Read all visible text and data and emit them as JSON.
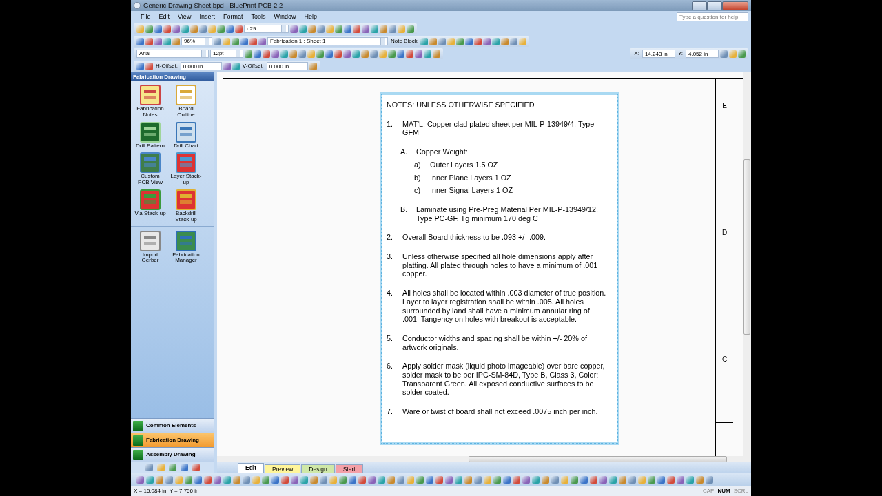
{
  "window": {
    "title": "Generic Drawing Sheet.bpd - BluePrint-PCB 2.2"
  },
  "help_box": {
    "placeholder": "Type a question for help"
  },
  "menu": [
    "File",
    "Edit",
    "View",
    "Insert",
    "Format",
    "Tools",
    "Window",
    "Help"
  ],
  "toolbars": [
    {
      "left": [
        {
          "kind": "icons"
        },
        {
          "kind": "combo",
          "value": "u29"
        },
        {
          "kind": "icons"
        }
      ]
    },
    {
      "left": [
        {
          "kind": "icons"
        },
        {
          "kind": "combo",
          "value": "96%"
        },
        {
          "kind": "icons"
        },
        {
          "kind": "combo",
          "value": "Fabrication 1 : Sheet 1"
        },
        {
          "kind": "menu",
          "value": "Note Block"
        },
        {
          "kind": "icons"
        }
      ]
    },
    {
      "left": [
        {
          "kind": "combo",
          "value": "Arial"
        },
        {
          "kind": "combo",
          "value": "12pt"
        },
        {
          "kind": "icons"
        }
      ],
      "right": [
        {
          "kind": "label",
          "value": "X:"
        },
        {
          "kind": "field",
          "value": "14.243 in"
        },
        {
          "kind": "label",
          "value": "Y:"
        },
        {
          "kind": "field",
          "value": "4.052 in"
        },
        {
          "kind": "icons"
        }
      ]
    },
    {
      "left": [
        {
          "kind": "icons"
        },
        {
          "kind": "label",
          "value": "H-Offset:"
        },
        {
          "kind": "field",
          "value": "0.000 in"
        },
        {
          "kind": "icons"
        },
        {
          "kind": "label",
          "value": "V-Offset:"
        },
        {
          "kind": "field",
          "value": "0.000 in"
        },
        {
          "kind": "icons"
        }
      ]
    }
  ],
  "sidebar": {
    "title": "Fabrication Drawing",
    "items": [
      {
        "label": "Fabrication Notes"
      },
      {
        "label": "Board Outline"
      },
      {
        "label": "Drill Pattern"
      },
      {
        "label": "Drill Chart"
      },
      {
        "label": "Custom PCB View"
      },
      {
        "label": "Layer Stack-up"
      },
      {
        "label": "Via Stack-up"
      },
      {
        "label": "Backdrill Stack-up"
      }
    ],
    "extra_items": [
      {
        "label": "Import Gerber"
      },
      {
        "label": "Fabrication Manager"
      }
    ],
    "sections": [
      {
        "label": "Common Elements",
        "selected": false
      },
      {
        "label": "Fabrication Drawing",
        "selected": true
      },
      {
        "label": "Assembly Drawing",
        "selected": false
      }
    ]
  },
  "document": {
    "title": "NOTES: UNLESS OTHERWISE SPECIFIED",
    "notes": [
      {
        "number": "1.",
        "text": "MAT'L: Copper clad plated sheet per MIL-P-13949/4, Type GFM.",
        "children": [
          {
            "number": "A.",
            "text": "Copper Weight:",
            "children": [
              {
                "number": "a)",
                "text": "Outer Layers 1.5 OZ"
              },
              {
                "number": "b)",
                "text": "Inner Plane Layers 1 OZ"
              },
              {
                "number": "c)",
                "text": "Inner Signal Layers 1 OZ"
              }
            ]
          },
          {
            "number": "B.",
            "text": "Laminate using Pre-Preg Material Per MIL-P-13949/12, Type PC-GF. Tg minimum 170 deg C"
          }
        ]
      },
      {
        "number": "2.",
        "text": "Overall Board thickness to be .093 +/- .009."
      },
      {
        "number": "3.",
        "text": "Unless otherwise specified all hole dimensions apply after platting. All plated through holes to have a minimum of .001 copper."
      },
      {
        "number": "4.",
        "text": "All holes shall be located within .003 diameter of true position. Layer to layer registration shall be within .005. All holes surrounded by land shall have a minimum annular ring of .001. Tangency on holes with breakout is acceptable."
      },
      {
        "number": "5.",
        "text": "Conductor widths and spacing shall be within +/- 20% of artwork originals."
      },
      {
        "number": "6.",
        "text": "Apply solder mask (liquid photo imageable) over bare copper, solder mask to be per IPC-SM-84D, Type B, Class 3, Color: Transparent Green. All exposed conductive surfaces to be solder coated."
      },
      {
        "number": "7.",
        "text": "Ware or twist of board shall not exceed .0075 inch per inch."
      }
    ],
    "zones": [
      "E",
      "D",
      "C"
    ]
  },
  "sheet_tabs": [
    {
      "label": "Edit",
      "color": "#ffffff",
      "selected": true
    },
    {
      "label": "Preview",
      "color": "#fff59a",
      "selected": false
    },
    {
      "label": "Design",
      "color": "#cfe8a8",
      "selected": false
    },
    {
      "label": "Start",
      "color": "#f4a0a8",
      "selected": false
    }
  ],
  "status_bar": {
    "coordinates": "X = 15.084 in, Y = 7.756 in",
    "indicators": [
      {
        "label": "CAP",
        "on": false
      },
      {
        "label": "NUM",
        "on": true
      },
      {
        "label": "SCRL",
        "on": false
      }
    ]
  }
}
